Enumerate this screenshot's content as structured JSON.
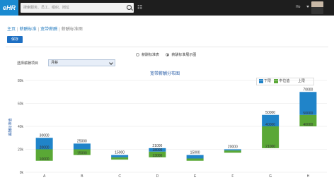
{
  "header": {
    "logo": "eHR",
    "search_placeholder": "搜索服务、员工、组织、岗位",
    "user_name": "Ho"
  },
  "breadcrumb": [
    "主页",
    "薪酬标准",
    "宽带薪酬",
    "薪酬标准图"
  ],
  "toolbar": {
    "save_label": "保存"
  },
  "view_options": [
    {
      "label": "薪酬标准表",
      "selected": false
    },
    {
      "label": "薪酬标准展示图",
      "selected": true
    }
  ],
  "filter": {
    "label": "选择薪酬项目",
    "value": "月薪"
  },
  "colors": {
    "lower": "#5aa836",
    "mid": "#2084c9",
    "upper": "#ffffff",
    "accent": "#1d6fc3"
  },
  "chart_data": {
    "type": "bar",
    "title": "宽带薪酬分布图",
    "ylabel": "薪酬标准值",
    "xlabel": "",
    "ylim": [
      0,
      80000
    ],
    "y_ticks": [
      "0k",
      "20k",
      "40k",
      "60k",
      "80k"
    ],
    "categories": [
      "A",
      "B",
      "C",
      "D",
      "E",
      "F",
      "G",
      "H"
    ],
    "series": [
      {
        "name": "下限",
        "values": [
          10000,
          15000,
          11000,
          13000,
          10000,
          17000,
          21000,
          40000
        ]
      },
      {
        "name": "中位值",
        "values": [
          20000,
          20000,
          13000,
          18000,
          12000,
          19000,
          40000,
          50000
        ]
      },
      {
        "name": "上限",
        "values": [
          30000,
          25000,
          15000,
          21000,
          15000,
          20000,
          50000,
          70000
        ]
      }
    ],
    "data_labels": {
      "top": [
        "30000",
        "25000",
        "15000",
        "21000",
        "15000",
        "20000",
        "50000",
        "70000"
      ],
      "mid": [
        "20000",
        "",
        "",
        "18000",
        "",
        "",
        "40000",
        "50000"
      ],
      "low": [
        "10000",
        "15000",
        "",
        "13000",
        "",
        "",
        "21000",
        "40000"
      ]
    },
    "legend": [
      "下限",
      "中位值",
      "上限"
    ],
    "legend_position": "top-right",
    "grid": true
  }
}
